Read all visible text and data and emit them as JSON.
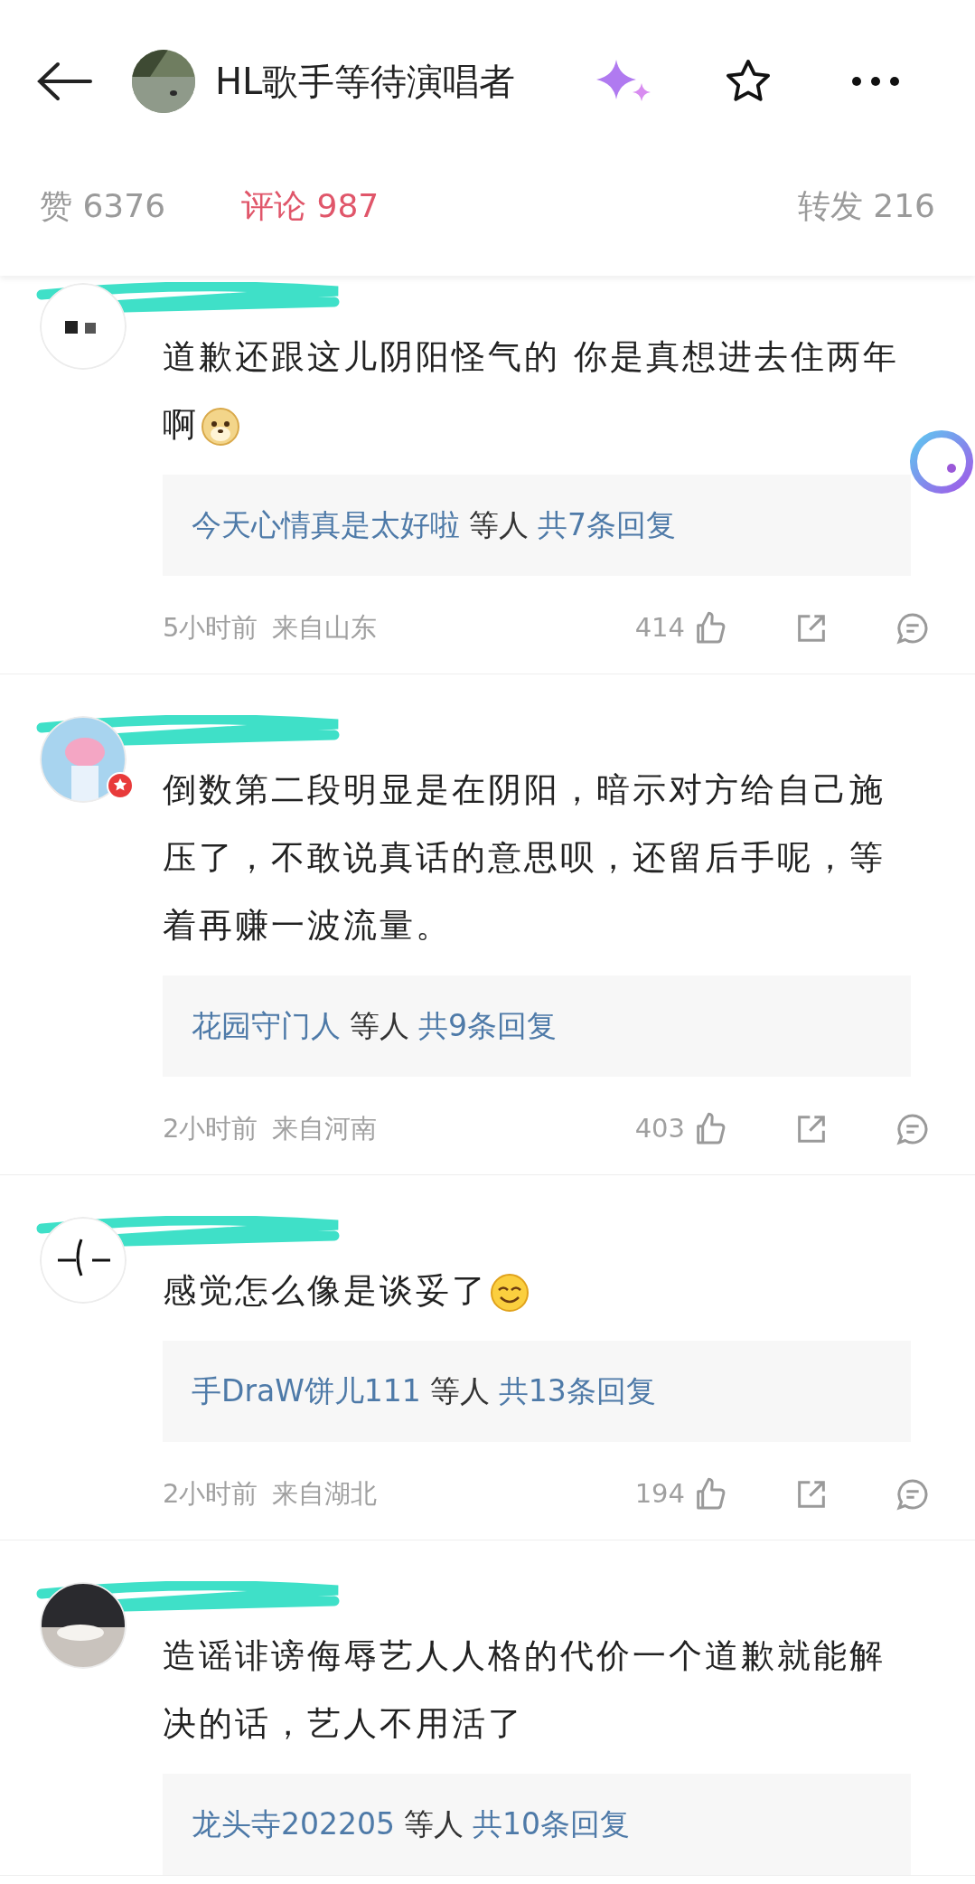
{
  "header": {
    "title": "HL歌手等待演唱者"
  },
  "tabs": [
    {
      "label": "赞 6376",
      "selected": false
    },
    {
      "label": "评论 987",
      "selected": true
    },
    {
      "label": "转发 216",
      "selected": false
    }
  ],
  "comments": [
    {
      "text": "道歉还跟这儿阴阳怪气的 你是真想进去住两年啊",
      "emoji": {
        "kind": "doge"
      },
      "verified": false,
      "reply_users": "今天心情真是太好啦",
      "reply_mid": "等人",
      "reply_count": "共7条回复",
      "time": "5小时前",
      "location": "来自山东",
      "likes": "414"
    },
    {
      "text": "倒数第二段明显是在阴阳，暗示对方给自己施压了，不敢说真话的意思呗，还留后手呢，等着再赚一波流量。",
      "verified": true,
      "reply_users": "花园守门人",
      "reply_mid": "等人",
      "reply_count": "共9条回复",
      "time": "2小时前",
      "location": "来自河南",
      "likes": "403"
    },
    {
      "text": "感觉怎么像是谈妥了",
      "emoji": {
        "kind": "smile"
      },
      "verified": false,
      "reply_users": "手DraW饼儿111",
      "reply_mid": "等人",
      "reply_count": "共13条回复",
      "time": "2小时前",
      "location": "来自湖北",
      "likes": "194"
    },
    {
      "text": "造谣诽谤侮辱艺人人格的代价一个道歉就能解决的话，艺人不用活了",
      "verified": false,
      "reply_users": "龙头寺202205",
      "reply_mid": "等人",
      "reply_count": "共10条回复"
    }
  ]
}
